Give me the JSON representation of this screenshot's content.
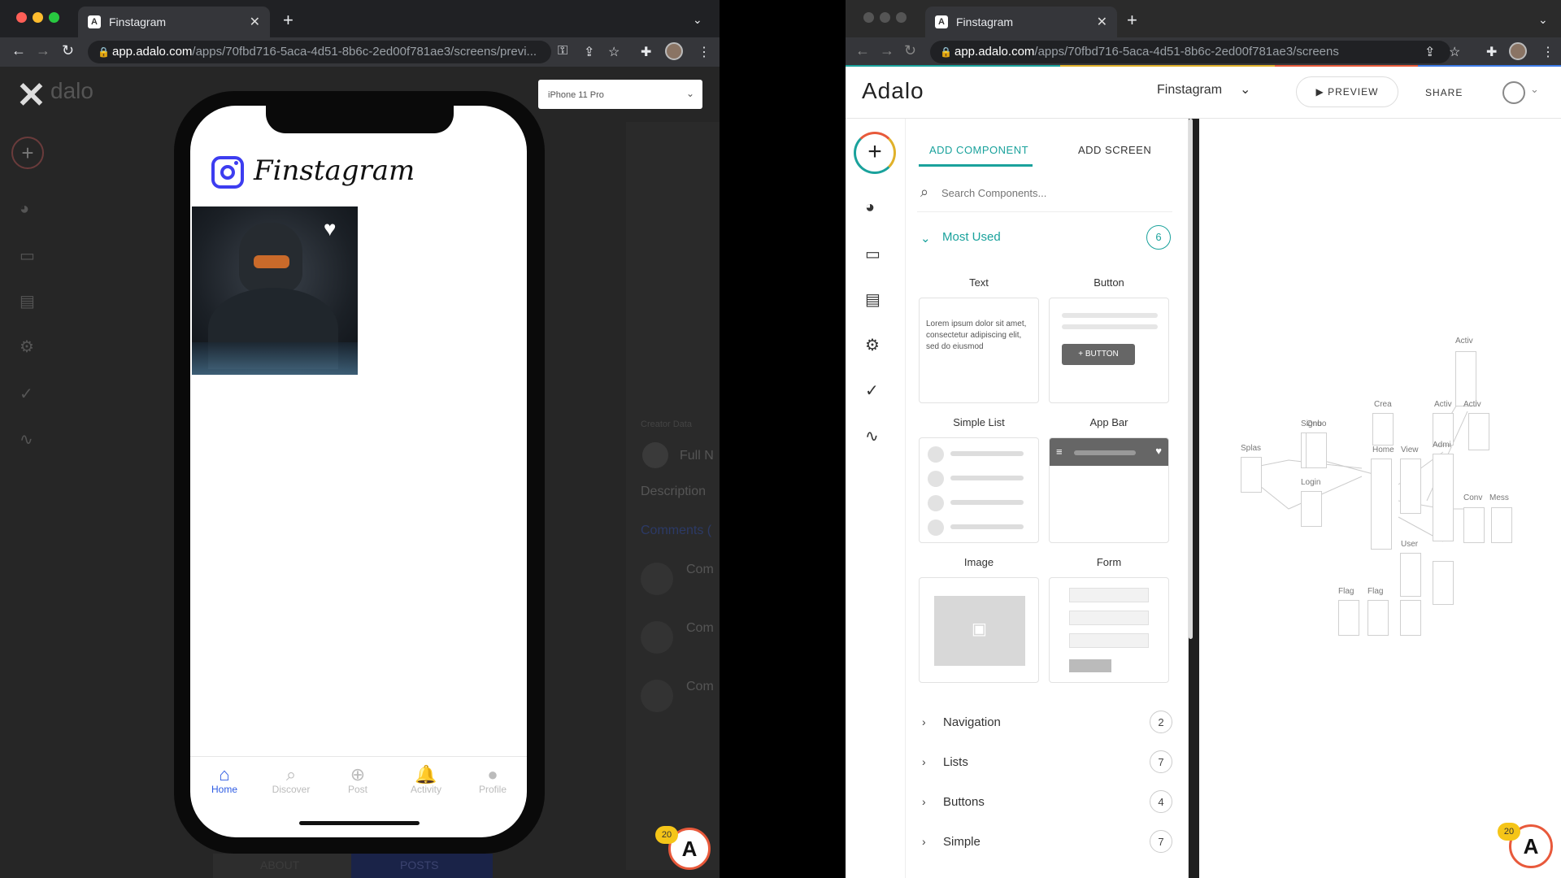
{
  "left_window": {
    "tab_title": "Finstagram",
    "url_host": "app.adalo.com",
    "url_path": "/apps/70fbd716-5aca-4d51-8b6c-2ed00f781ae3/screens/previ...",
    "device_select": "iPhone 11 Pro",
    "logo_text": "dalo",
    "bg_labels": {
      "description": "Description",
      "comments": "Comments (",
      "full_name": "Full N",
      "creator": "Creator Data",
      "comment_items": [
        "Com",
        "Com",
        "Com"
      ],
      "bottom_tabs": [
        "ABOUT",
        "POSTS"
      ]
    },
    "app": {
      "title": "Finstagram",
      "tabs": [
        {
          "label": "Home",
          "icon": "home-icon"
        },
        {
          "label": "Discover",
          "icon": "search-icon"
        },
        {
          "label": "Post",
          "icon": "add-circle-icon"
        },
        {
          "label": "Activity",
          "icon": "bell-icon"
        },
        {
          "label": "Profile",
          "icon": "profile-icon"
        }
      ]
    },
    "badge_count": "20"
  },
  "right_window": {
    "tab_title": "Finstagram",
    "url_host": "app.adalo.com",
    "url_path": "/apps/70fbd716-5aca-4d51-8b6c-2ed00f781ae3/screens",
    "logo_text": "Adalo",
    "app_name": "Finstagram",
    "preview_label": "PREVIEW",
    "share_label": "SHARE",
    "panel_tabs": [
      "ADD COMPONENT",
      "ADD SCREEN"
    ],
    "search_placeholder": "Search Components...",
    "most_used": {
      "label": "Most Used",
      "count": "6"
    },
    "components": [
      {
        "label": "Text",
        "text": "Lorem ipsum dolor sit amet, consectetur adipiscing elit, sed do eiusmod"
      },
      {
        "label": "Button",
        "button_text": "+ BUTTON"
      },
      {
        "label": "Simple List"
      },
      {
        "label": "App Bar"
      },
      {
        "label": "Image"
      },
      {
        "label": "Form"
      }
    ],
    "categories": [
      {
        "label": "Navigation",
        "count": "2"
      },
      {
        "label": "Lists",
        "count": "7"
      },
      {
        "label": "Buttons",
        "count": "4"
      },
      {
        "label": "Simple",
        "count": "7"
      }
    ],
    "canvas_labels": [
      "Activ",
      "Crea",
      "Activ",
      "Activ",
      "Signu",
      "Onbo",
      "Splas",
      "Home",
      "View",
      "Admi",
      "Login",
      "Conv",
      "Mess",
      "User",
      "Flag",
      "Flag"
    ],
    "badge_count": "20"
  },
  "colors": {
    "accent_teal": "#1aa29c",
    "brand_purple": "#3d3df0",
    "ios_blue": "#2d5be3"
  }
}
